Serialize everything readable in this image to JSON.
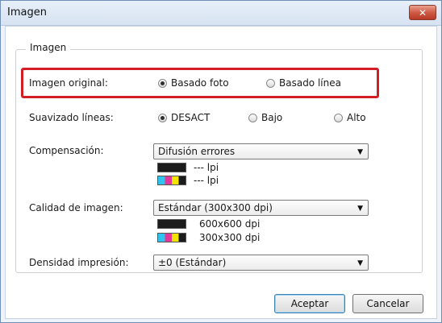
{
  "window": {
    "title": "Imagen",
    "close_glyph": "✕"
  },
  "group": {
    "title": "Imagen"
  },
  "image_original": {
    "label": "Imagen original:",
    "options": [
      "Basado foto",
      "Basado línea"
    ],
    "selected": "Basado foto"
  },
  "smoothing": {
    "label": "Suavizado líneas:",
    "options": [
      "DESACT",
      "Bajo",
      "Alto"
    ],
    "selected": "DESACT"
  },
  "compensation": {
    "label": "Compensación:",
    "value": "Difusión errores",
    "black_lpi": "--- lpi",
    "color_lpi": "--- lpi"
  },
  "quality": {
    "label": "Calidad de imagen:",
    "value": "Estándar (300x300 dpi)",
    "black_dpi": "600x600 dpi",
    "color_dpi": "300x300 dpi"
  },
  "density": {
    "label": "Densidad impresión:",
    "value": "±0 (Estándar)"
  },
  "buttons": {
    "accept": "Aceptar",
    "cancel": "Cancelar"
  },
  "icons": {
    "dropdown": "chevron-down-icon",
    "close": "close-icon"
  },
  "colors": {
    "highlight": "#d21f26"
  }
}
